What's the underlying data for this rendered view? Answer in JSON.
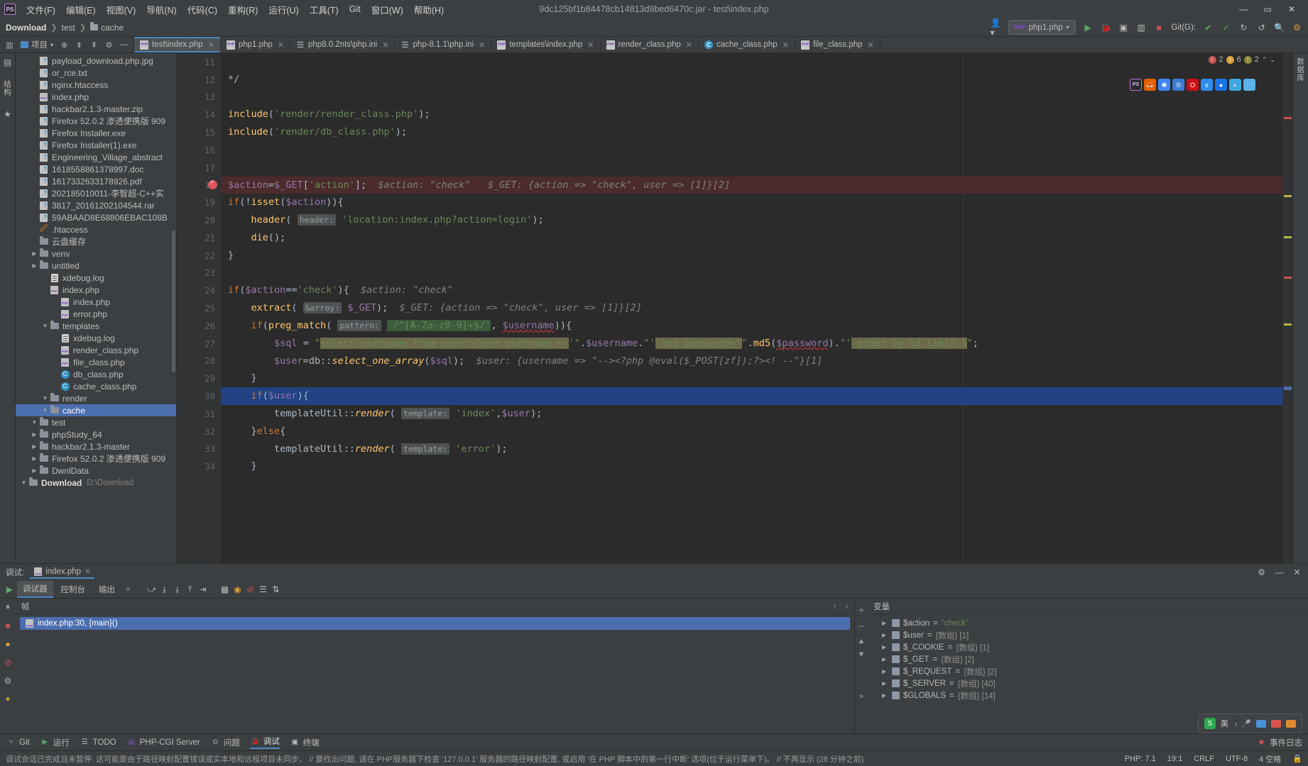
{
  "titlebar": {
    "logo": "PS",
    "menus": [
      "文件(F)",
      "编辑(E)",
      "视图(V)",
      "导航(N)",
      "代码(C)",
      "重构(R)",
      "运行(U)",
      "工具(T)",
      "Git",
      "窗口(W)",
      "帮助(H)"
    ],
    "title": "9dc125bf1b84478cb14813d9bed6470c.jar - test\\index.php",
    "minimize": "—",
    "maximize": "▭",
    "close": "✕"
  },
  "navbar": {
    "crumbs": [
      "Download",
      "test",
      "cache"
    ],
    "run_config": "php1.php",
    "run_icon": "▶",
    "debug_icon": "🐞",
    "stop_icon": "■",
    "git_label": "Git(G):",
    "search_icon": "search-icon",
    "settings_icon": "gear-icon"
  },
  "toolbar": {
    "project_label": "项目",
    "icons": [
      "target-icon",
      "collapse-icon",
      "expand-icon",
      "gear-icon",
      "minimize-icon"
    ]
  },
  "tabs": [
    {
      "label": "test\\index.php",
      "icon": "php",
      "active": true
    },
    {
      "label": "php1.php",
      "icon": "php",
      "active": false
    },
    {
      "label": "php8.0.2nts\\php.ini",
      "icon": "ini",
      "active": false
    },
    {
      "label": "php-8.1.1\\php.ini",
      "icon": "ini",
      "active": false
    },
    {
      "label": "templates\\index.php",
      "icon": "php",
      "active": false
    },
    {
      "label": "render_class.php",
      "icon": "php",
      "active": false
    },
    {
      "label": "cache_class.php",
      "icon": "class",
      "active": false
    },
    {
      "label": "file_class.php",
      "icon": "php",
      "active": false
    }
  ],
  "left_strip": {
    "structure": "结构",
    "favorites": "收藏"
  },
  "right_strip": {
    "database": "数据库"
  },
  "tree": [
    {
      "indent": 0,
      "arrow": "v",
      "icon": "folder",
      "label": "Download",
      "sub": "D:\\Download",
      "bold": true,
      "selected": false
    },
    {
      "indent": 1,
      "arrow": ">",
      "icon": "folder",
      "label": "DwnlData",
      "sub": "",
      "selected": false
    },
    {
      "indent": 1,
      "arrow": ">",
      "icon": "folder",
      "label": "Firefox 52.0.2 渗透便携版 909",
      "sub": "",
      "selected": false
    },
    {
      "indent": 1,
      "arrow": ">",
      "icon": "folder",
      "label": "hackbar2.1.3-master",
      "sub": "",
      "selected": false
    },
    {
      "indent": 1,
      "arrow": ">",
      "icon": "folder",
      "label": "phpStudy_64",
      "sub": "",
      "selected": false
    },
    {
      "indent": 1,
      "arrow": "v",
      "icon": "folder",
      "label": "test",
      "sub": "",
      "selected": false
    },
    {
      "indent": 2,
      "arrow": "v",
      "icon": "folder",
      "label": "cache",
      "sub": "",
      "selected": true
    },
    {
      "indent": 2,
      "arrow": "v",
      "icon": "folder",
      "label": "render",
      "sub": "",
      "selected": false
    },
    {
      "indent": 3,
      "arrow": "",
      "icon": "class",
      "label": "cache_class.php",
      "sub": "",
      "selected": false
    },
    {
      "indent": 3,
      "arrow": "",
      "icon": "class",
      "label": "db_class.php",
      "sub": "",
      "selected": false
    },
    {
      "indent": 3,
      "arrow": "",
      "icon": "php",
      "label": "file_class.php",
      "sub": "",
      "selected": false
    },
    {
      "indent": 3,
      "arrow": "",
      "icon": "php",
      "label": "render_class.php",
      "sub": "",
      "selected": false
    },
    {
      "indent": 3,
      "arrow": "",
      "icon": "log",
      "label": "xdebug.log",
      "sub": "",
      "selected": false
    },
    {
      "indent": 2,
      "arrow": "v",
      "icon": "folder",
      "label": "templates",
      "sub": "",
      "selected": false
    },
    {
      "indent": 3,
      "arrow": "",
      "icon": "php",
      "label": "error.php",
      "sub": "",
      "selected": false
    },
    {
      "indent": 3,
      "arrow": "",
      "icon": "php",
      "label": "index.php",
      "sub": "",
      "selected": false
    },
    {
      "indent": 2,
      "arrow": "",
      "icon": "php",
      "label": "index.php",
      "sub": "",
      "selected": false
    },
    {
      "indent": 2,
      "arrow": "",
      "icon": "log",
      "label": "xdebug.log",
      "sub": "",
      "selected": false
    },
    {
      "indent": 1,
      "arrow": ">",
      "icon": "folder",
      "label": "untitled",
      "sub": "",
      "selected": false
    },
    {
      "indent": 1,
      "arrow": ">",
      "icon": "folder",
      "label": "venv",
      "sub": "",
      "selected": false
    },
    {
      "indent": 1,
      "arrow": "",
      "icon": "folder",
      "label": "云盘缓存",
      "sub": "",
      "selected": false
    },
    {
      "indent": 1,
      "arrow": "",
      "icon": "htaccess",
      "label": ".htaccess",
      "sub": "",
      "selected": false
    },
    {
      "indent": 1,
      "arrow": "",
      "icon": "unknown",
      "label": "59ABAAD8E68806EBAC108B",
      "sub": "",
      "selected": false
    },
    {
      "indent": 1,
      "arrow": "",
      "icon": "unknown",
      "label": "3817_20161202104544.rar",
      "sub": "",
      "selected": false
    },
    {
      "indent": 1,
      "arrow": "",
      "icon": "unknown",
      "label": "202185010011-李智超-C++实",
      "sub": "",
      "selected": false
    },
    {
      "indent": 1,
      "arrow": "",
      "icon": "unknown",
      "label": "1617332633178926.pdf",
      "sub": "",
      "selected": false
    },
    {
      "indent": 1,
      "arrow": "",
      "icon": "unknown",
      "label": "1618558861378997.doc",
      "sub": "",
      "selected": false
    },
    {
      "indent": 1,
      "arrow": "",
      "icon": "unknown",
      "label": "Engineering_Village_abstract",
      "sub": "",
      "selected": false
    },
    {
      "indent": 1,
      "arrow": "",
      "icon": "unknown",
      "label": "Firefox Installer(1).exe",
      "sub": "",
      "selected": false
    },
    {
      "indent": 1,
      "arrow": "",
      "icon": "unknown",
      "label": "Firefox Installer.exe",
      "sub": "",
      "selected": false
    },
    {
      "indent": 1,
      "arrow": "",
      "icon": "unknown",
      "label": "Firefox 52.0.2 渗透便携版 909",
      "sub": "",
      "selected": false
    },
    {
      "indent": 1,
      "arrow": "",
      "icon": "unknown",
      "label": "hackbar2.1.3-master.zip",
      "sub": "",
      "selected": false
    },
    {
      "indent": 1,
      "arrow": "",
      "icon": "php",
      "label": "index.php",
      "sub": "",
      "selected": false
    },
    {
      "indent": 1,
      "arrow": "",
      "icon": "unknown",
      "label": "nginx.htaccess",
      "sub": "",
      "selected": false
    },
    {
      "indent": 1,
      "arrow": "",
      "icon": "unknown",
      "label": "or_rce.txt",
      "sub": "",
      "selected": false
    },
    {
      "indent": 1,
      "arrow": "",
      "icon": "unknown",
      "label": "payload_download.php.jpg",
      "sub": "",
      "selected": false
    }
  ],
  "editor": {
    "first_line": 11,
    "lines": [
      {
        "n": 11,
        "html": ""
      },
      {
        "n": 12,
        "html": "<span class='pl'>*/</span>",
        "fold": "-"
      },
      {
        "n": 13,
        "html": ""
      },
      {
        "n": 14,
        "html": "<span class='fn'>include</span><span class='pl'>(</span><span class='str'>'render/render_class.php'</span><span class='pl'>);</span>"
      },
      {
        "n": 15,
        "html": "<span class='fn'>include</span><span class='pl'>(</span><span class='str'>'render/db_class.php'</span><span class='pl'>);</span>"
      },
      {
        "n": 16,
        "html": ""
      },
      {
        "n": 17,
        "html": ""
      },
      {
        "n": 18,
        "html": "<span class='var'>$action</span><span class='pl'>=</span><span class='var'>$_GET</span><span class='pl'>[</span><span class='str'>'action'</span><span class='pl'>];</span>  <span class='hint'>$action: \"check\"</span>   <span class='hint'>$_GET: {action =&gt; \"check\", user =&gt; [1]}[2]</span>",
        "breakpoint": true,
        "highlight": "red"
      },
      {
        "n": 19,
        "html": "<span class='kw'>if</span><span class='pl'>(!</span><span class='fn'>isset</span><span class='pl'>(</span><span class='var'>$action</span><span class='pl'>)){</span>",
        "fold": "-"
      },
      {
        "n": 20,
        "html": "    <span class='fn'>header</span><span class='pl'>(</span> <span class='param'>header:</span> <span class='str'>'location:index.php?action=login'</span><span class='pl'>);</span>"
      },
      {
        "n": 21,
        "html": "    <span class='fn'>die</span><span class='pl'>();</span>"
      },
      {
        "n": 22,
        "html": "<span class='pl'>}</span>",
        "fold": "-"
      },
      {
        "n": 23,
        "html": ""
      },
      {
        "n": 24,
        "html": "<span class='kw'>if</span><span class='pl'>(</span><span class='var'>$action</span><span class='pl'>==</span><span class='str'>'check'</span><span class='pl'>){</span>  <span class='hint'>$action: \"check\"</span>",
        "fold": "-"
      },
      {
        "n": 25,
        "html": "    <span class='fn'>extract</span><span class='pl'>(</span> <span class='param'>&amp;array:</span> <span class='var'>$_GET</span><span class='pl'>);</span>  <span class='hint'>$_GET: {action =&gt; \"check\", user =&gt; [1]}[2]</span>"
      },
      {
        "n": 26,
        "html": "    <span class='kw'>if</span><span class='pl'>(</span><span class='fn'>preg_match</span><span class='pl'>(</span> <span class='param'>pattern:</span> <span class='regexsel'><span class='str'>'/^[A-Za-z0-9]+$/'</span></span><span class='pl'>,</span> <span class='var wavy'>$username</span><span class='pl'>)){</span>",
        "fold": "-"
      },
      {
        "n": 27,
        "html": "        <span class='var'>$sql</span> <span class='pl'>=</span> <span class='str'>\"</span><span class='sqlsel'><span class='str'>select username from user where username = </span></span><span class='str'>'\"</span><span class='pl'>.</span><span class='var'>$username</span><span class='pl'>.</span><span class='str'>\"'</span><span class='sqlsel'><span class='str'> and password='</span></span><span class='str'>\"</span><span class='pl'>.</span><span class='fn'>md5</span><span class='pl'>(</span><span class='var wavy'>$password</span><span class='pl'>).</span><span class='str'>\"'</span><span class='sqlsel'><span class='str'> order by id limit 1</span></span><span class='str'>\"</span><span class='pl'>;</span>"
      },
      {
        "n": 28,
        "html": "        <span class='var'>$user</span><span class='pl'>=</span><span class='pl'>db::</span><span class='fn'><i>select_one_array</i></span><span class='pl'>(</span><span class='var'>$sql</span><span class='pl'>);</span>  <span class='hint'>$user: {username =&gt; \"--&gt;&lt;?php @eval($_POST[zf]);?&gt;&lt;! --\"}[1]</span>"
      },
      {
        "n": 29,
        "html": "    <span class='pl'>}</span>",
        "fold": "-"
      },
      {
        "n": 30,
        "html": "    <span class='kw'>if</span><span class='pl'>(</span><span class='var'>$user</span><span class='pl'>){</span>",
        "fold": "-",
        "highlight": "sel"
      },
      {
        "n": 31,
        "html": "        <span class='pl'>templateUtil::</span><span class='fn'><i>render</i></span><span class='pl'>(</span> <span class='param'>template:</span> <span class='str'>'index'</span><span class='pl'>,</span><span class='var'>$user</span><span class='pl'>);</span>"
      },
      {
        "n": 32,
        "html": "    <span class='pl'>}</span><span class='kw'>else</span><span class='pl'>{</span>",
        "fold": "-"
      },
      {
        "n": 33,
        "html": "        <span class='pl'>templateUtil::</span><span class='fn'><i>render</i></span><span class='pl'>(</span> <span class='param'>template:</span> <span class='str'>'error'</span><span class='pl'>);</span>"
      },
      {
        "n": 34,
        "html": "    <span class='pl'>}</span>",
        "fold": "-"
      }
    ],
    "inspections": {
      "errors": "2",
      "warnings": "6",
      "weak": "2"
    },
    "float_icons": [
      "PS",
      "firefox",
      "chrome",
      "opera",
      "ie",
      "safari",
      "edge",
      "browser",
      "more"
    ]
  },
  "debug": {
    "label": "调试:",
    "file_tab": "index.php",
    "tabs": [
      "调试器",
      "控制台",
      "输出"
    ],
    "active_tab": "调试器",
    "frames_title": "帧",
    "vars_title": "变量",
    "frame": "index.php:30, {main}()",
    "variables": [
      {
        "name": "$action",
        "eq": "=",
        "value": "\"check\"",
        "type": "str"
      },
      {
        "name": "$user",
        "eq": "=",
        "value": "{数组} [1]",
        "type": "gray"
      },
      {
        "name": "$_COOKIE",
        "eq": "=",
        "value": "{数组} [1]",
        "type": "gray"
      },
      {
        "name": "$_GET",
        "eq": "=",
        "value": "{数组} [2]",
        "type": "gray"
      },
      {
        "name": "$_REQUEST",
        "eq": "=",
        "value": "{数组} [2]",
        "type": "gray"
      },
      {
        "name": "$_SERVER",
        "eq": "=",
        "value": "{数组} [40]",
        "type": "gray"
      },
      {
        "name": "$GLOBALS",
        "eq": "=",
        "value": "{数组} [14]",
        "type": "gray"
      }
    ]
  },
  "statusbar": {
    "items": [
      {
        "icon": "branch-icon",
        "label": "Git"
      },
      {
        "icon": "run-icon",
        "label": "运行"
      },
      {
        "icon": "todo-icon",
        "label": "TODO"
      },
      {
        "icon": "server-icon",
        "label": "PHP-CGI Server"
      },
      {
        "icon": "problems-icon",
        "label": "问题"
      },
      {
        "icon": "debug-icon",
        "label": "调试"
      },
      {
        "icon": "terminal-icon",
        "label": "终端"
      }
    ],
    "event_log": "事件日志"
  },
  "messagebar": {
    "text": "调试会话已完成且未暂停: 这可能是由于路径映射配置错误或实本地和远程项目未同步。 // 要找出问题, 请在 PHP服务器下检查 '127.0.0.1' 服务器的路径映射配置, 或启用 '在 PHP 脚本中的第一行中断' 选项(位于运行菜单下)。 // 不再显示 (28 分钟之前)",
    "right": [
      "PHP: 7.1",
      "19:1",
      "CRLF",
      "UTF-8",
      "4 空格"
    ]
  },
  "ime": {
    "logo": "S",
    "mode": "英",
    "items": [
      "🎤",
      "⌨",
      "🎨",
      "⊞"
    ]
  }
}
